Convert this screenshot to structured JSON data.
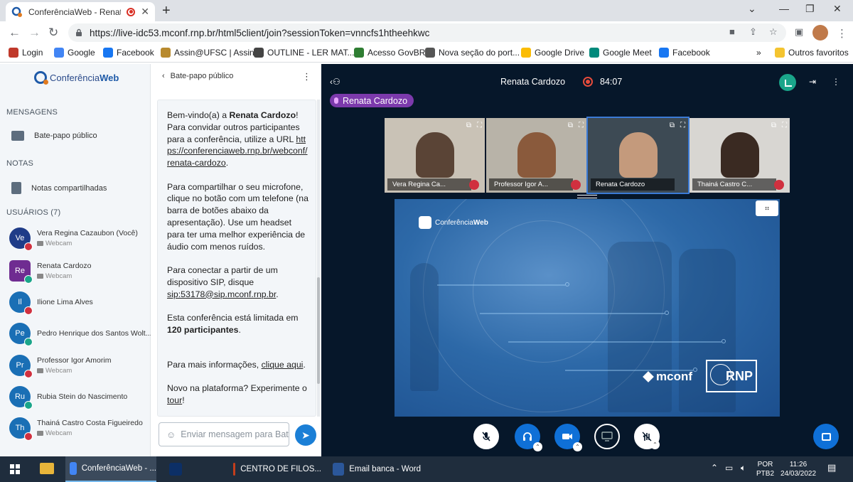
{
  "browser": {
    "tab_title": "ConferênciaWeb - Renata Ca",
    "url": "https://live-idc53.mconf.rnp.br/html5client/join?sessionToken=vnncfs1htheehkwc"
  },
  "bookmarks": [
    {
      "label": "Login",
      "color": "#c0392b"
    },
    {
      "label": "Google",
      "color": "#4285f4"
    },
    {
      "label": "Facebook",
      "color": "#1877f2"
    },
    {
      "label": "Assin@UFSC | Assin...",
      "color": "#b88a2e"
    },
    {
      "label": "OUTLINE - LER MAT...",
      "color": "#444444"
    },
    {
      "label": "Acesso GovBR",
      "color": "#2e7d32"
    },
    {
      "label": "Nova seção do port...",
      "color": "#555555"
    },
    {
      "label": "Google Drive",
      "color": "#fbbc04"
    },
    {
      "label": "Google Meet",
      "color": "#00897b"
    },
    {
      "label": "Facebook",
      "color": "#1877f2"
    }
  ],
  "bookmarks_overflow": "»",
  "bookmarks_other": "Outros favoritos",
  "app": {
    "logo_prefix": "Conferência",
    "logo_suffix": "Web"
  },
  "sidebar": {
    "messages_title": "MENSAGENS",
    "public_chat": "Bate-papo público",
    "notes_title": "NOTAS",
    "shared_notes": "Notas compartilhadas",
    "users_title": "USUÁRIOS  (7)",
    "users": [
      {
        "initials": "Ve",
        "name": "Vera Regina Cazaubon  (Você)",
        "sub": "Webcam",
        "color": "#1f3c88",
        "badge": "#d0303f"
      },
      {
        "initials": "Re",
        "name": "Renata Cardozo",
        "sub": "Webcam",
        "color": "#6f2c91",
        "badge": "#1aa58a",
        "square": true
      },
      {
        "initials": "Il",
        "name": "Ilione Lima Alves",
        "sub": "",
        "color": "#1a6fb5",
        "badge": "#d0303f"
      },
      {
        "initials": "Pe",
        "name": "Pedro Henrique dos Santos Wolt...",
        "sub": "",
        "color": "#1a6fb5",
        "badge": "#1aa58a"
      },
      {
        "initials": "Pr",
        "name": "Professor Igor Amorim",
        "sub": "Webcam",
        "color": "#1a6fb5",
        "badge": "#d0303f"
      },
      {
        "initials": "Ru",
        "name": "Rubia Stein do Nascimento",
        "sub": "",
        "color": "#1a6fb5",
        "badge": "#1aa58a"
      },
      {
        "initials": "Th",
        "name": "Thainá Castro Costa Figueiredo",
        "sub": "Webcam",
        "color": "#1a6fb5",
        "badge": "#d0303f"
      }
    ]
  },
  "chat": {
    "title": "Bate-papo público",
    "welcome_prefix": "Bem-vindo(a) a ",
    "welcome_name": "Renata Cardozo",
    "welcome_rest": "! Para convidar outros participantes para a conferência, utilize a URL ",
    "welcome_link": "https://conferenciaweb.rnp.br/webconf/renata-cardozo",
    "p2": "Para compartilhar o seu microfone, clique no botão com um telefone (na barra de botões abaixo da apresentação). Use um headset para ter uma melhor experiência de áudio com menos ruídos.",
    "p3_prefix": "Para conectar a partir de um dispositivo SIP, disque ",
    "p3_link": "sip:53178@sip.mconf.rnp.br",
    "p4_prefix": "Esta conferência está limitada em ",
    "p4_bold": "120 participantes",
    "p5_prefix": "Para mais informações, ",
    "p5_link": "clique aqui",
    "p6_prefix": "Novo na plataforma? Experimente o ",
    "p6_link": "tour",
    "input_placeholder": "Enviar mensagem para Bate-papo público"
  },
  "meeting": {
    "presenter": "Renata Cardozo",
    "timer": "84:07",
    "talking": "Renata Cardozo",
    "videos": [
      {
        "name": "Vera Regina Ca...",
        "bg": "#c9c2b6",
        "person": "#5a4436",
        "muted": true
      },
      {
        "name": "Professor Igor A...",
        "bg": "#b8b3a8",
        "person": "#8a5a3c",
        "muted": true
      },
      {
        "name": "Renata Cardozo",
        "bg": "#3d4a54",
        "person": "#c49a7c",
        "muted": false
      },
      {
        "name": "Thainá Castro C...",
        "bg": "#d8d6d2",
        "person": "#3a2a22",
        "muted": true
      }
    ],
    "slide_logo_prefix": "Conferência",
    "slide_logo_suffix": "Web",
    "slide_mconf": "mconf",
    "slide_rnp": "RNP"
  },
  "taskbar": {
    "items": [
      {
        "label": "ConferênciaWeb - ...",
        "color": "#4285f4",
        "active": true
      },
      {
        "label": "",
        "color": "#0c2f66"
      },
      {
        "label": "CENTRO DE FILOS...",
        "color": "#c43e1c"
      },
      {
        "label": "Email banca - Word",
        "color": "#2b579a"
      }
    ],
    "lang_top": "POR",
    "lang_bottom": "PTB2",
    "time": "11:26",
    "date": "24/03/2022"
  }
}
